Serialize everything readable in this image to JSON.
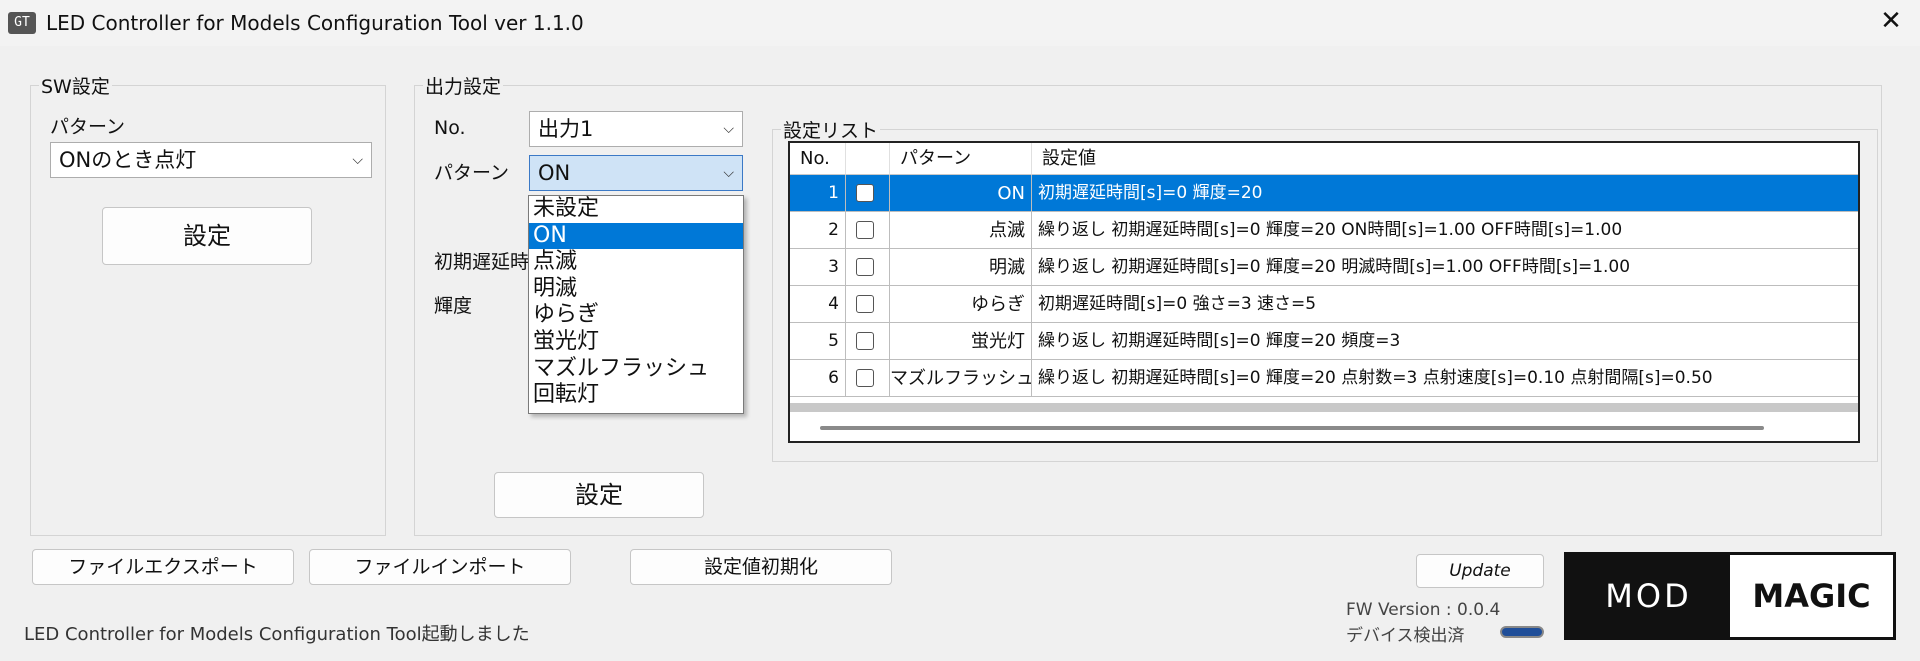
{
  "window": {
    "app_icon": "GT",
    "title": "LED Controller for Models Configuration Tool ver 1.1.0",
    "close_glyph": "✕"
  },
  "sw": {
    "group_label": "SW設定",
    "pattern_label": "パターン",
    "pattern_value": "ONのとき点灯",
    "set_label": "設定"
  },
  "output": {
    "group_label": "出力設定",
    "no_label": "No.",
    "no_value": "出力1",
    "pattern_label": "パターン",
    "pattern_value": "ON",
    "delay_label": "初期遅延時間[s]",
    "brightness_label": "輝度",
    "set_label": "設定",
    "options": [
      "未設定",
      "ON",
      "点滅",
      "明滅",
      "ゆらぎ",
      "蛍光灯",
      "マズルフラッシュ",
      "回転灯"
    ],
    "selected_option": 1
  },
  "list": {
    "group_label": "設定リスト",
    "headers": [
      "No.",
      "",
      "パターン",
      "設定値"
    ],
    "rows": [
      {
        "no": "1",
        "pattern": "ON",
        "value": "初期遅延時間[s]=0 輝度=20",
        "selected": true
      },
      {
        "no": "2",
        "pattern": "点滅",
        "value": "繰り返し 初期遅延時間[s]=0 輝度=20 ON時間[s]=1.00 OFF時間[s]=1.00",
        "selected": false
      },
      {
        "no": "3",
        "pattern": "明滅",
        "value": "繰り返し 初期遅延時間[s]=0 輝度=20 明滅時間[s]=1.00 OFF時間[s]=1.00",
        "selected": false
      },
      {
        "no": "4",
        "pattern": "ゆらぎ",
        "value": "初期遅延時間[s]=0 強さ=3 速さ=5",
        "selected": false
      },
      {
        "no": "5",
        "pattern": "蛍光灯",
        "value": "繰り返し 初期遅延時間[s]=0 輝度=20 頻度=3",
        "selected": false
      },
      {
        "no": "6",
        "pattern": "マズルフラッシュ",
        "value": "繰り返し 初期遅延時間[s]=0 輝度=20 点射数=3 点射速度[s]=0.10 点射間隔[s]=0.50",
        "selected": false
      }
    ]
  },
  "bottom": {
    "export_label": "ファイルエクスポート",
    "import_label": "ファイルインポート",
    "reset_label": "設定値初期化",
    "update_label": "Update",
    "fw_version": "FW Version : 0.0.4",
    "device_status": "デバイス検出済",
    "status_message": "LED Controller for Models Configuration Tool起動しました"
  },
  "logo": {
    "left_text": "MOD",
    "right_text": "MAGIC"
  },
  "colors": {
    "selection": "#0078d7",
    "focus": "#cfe3f6"
  }
}
